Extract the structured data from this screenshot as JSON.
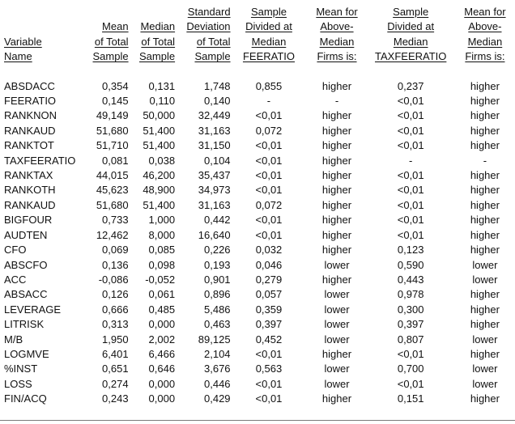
{
  "table": {
    "headers": [
      {
        "key": "variable",
        "lines": [
          "",
          "",
          "Variable",
          "Name"
        ]
      },
      {
        "key": "mean",
        "lines": [
          "",
          "Mean",
          "of Total",
          "Sample"
        ]
      },
      {
        "key": "median",
        "lines": [
          "",
          "Median",
          "of Total",
          "Sample"
        ]
      },
      {
        "key": "sd",
        "lines": [
          "Standard",
          "Deviation",
          "of Total",
          "Sample"
        ]
      },
      {
        "key": "fee_split",
        "lines": [
          "Sample",
          "Divided at",
          "Median",
          "FEERATIO"
        ]
      },
      {
        "key": "fee_direction",
        "lines": [
          "Mean for",
          "Above-",
          "Median",
          "Firms is:"
        ]
      },
      {
        "key": "tax_split",
        "lines": [
          "Sample",
          "Divided at",
          "Median",
          "TAXFEERATIO"
        ]
      },
      {
        "key": "tax_direction",
        "lines": [
          "Mean for",
          "Above-",
          "Median",
          "Firms is:"
        ]
      }
    ],
    "rows": [
      [
        "ABSDACC",
        "0,354",
        "0,131",
        "1,748",
        "0,855",
        "higher",
        "0,237",
        "higher"
      ],
      [
        "FEERATIO",
        "0,145",
        "0,110",
        "0,140",
        "-",
        "-",
        "<0,01",
        "higher"
      ],
      [
        "RANKNON",
        "49,149",
        "50,000",
        "32,449",
        "<0,01",
        "higher",
        "<0,01",
        "higher"
      ],
      [
        "RANKAUD",
        "51,680",
        "51,400",
        "31,163",
        "0,072",
        "higher",
        "<0,01",
        "higher"
      ],
      [
        "RANKTOT",
        "51,710",
        "51,400",
        "31,150",
        "<0,01",
        "higher",
        "<0,01",
        "higher"
      ],
      [
        "TAXFEERATIO",
        "0,081",
        "0,038",
        "0,104",
        "<0,01",
        "higher",
        "-",
        "-"
      ],
      [
        "RANKTAX",
        "44,015",
        "46,200",
        "35,437",
        "<0,01",
        "higher",
        "<0,01",
        "higher"
      ],
      [
        "RANKOTH",
        "45,623",
        "48,900",
        "34,973",
        "<0,01",
        "higher",
        "<0,01",
        "higher"
      ],
      [
        "RANKAUD",
        "51,680",
        "51,400",
        "31,163",
        "0,072",
        "higher",
        "<0,01",
        "higher"
      ],
      [
        "BIGFOUR",
        "0,733",
        "1,000",
        "0,442",
        "<0,01",
        "higher",
        "<0,01",
        "higher"
      ],
      [
        "AUDTEN",
        "12,462",
        "8,000",
        "16,640",
        "<0,01",
        "higher",
        "<0,01",
        "higher"
      ],
      [
        "CFO",
        "0,069",
        "0,085",
        "0,226",
        "0,032",
        "higher",
        "0,123",
        "higher"
      ],
      [
        "ABSCFO",
        "0,136",
        "0,098",
        "0,193",
        "0,046",
        "lower",
        "0,590",
        "lower"
      ],
      [
        "ACC",
        "-0,086",
        "-0,052",
        "0,901",
        "0,279",
        "higher",
        "0,443",
        "lower"
      ],
      [
        "ABSACC",
        "0,126",
        "0,061",
        "0,896",
        "0,057",
        "lower",
        "0,978",
        "higher"
      ],
      [
        "LEVERAGE",
        "0,666",
        "0,485",
        "5,486",
        "0,359",
        "lower",
        "0,300",
        "higher"
      ],
      [
        "LITRISK",
        "0,313",
        "0,000",
        "0,463",
        "0,397",
        "lower",
        "0,397",
        "higher"
      ],
      [
        "M/B",
        "1,950",
        "2,002",
        "89,125",
        "0,452",
        "lower",
        "0,807",
        "lower"
      ],
      [
        "LOGMVE",
        "6,401",
        "6,466",
        "2,104",
        "<0,01",
        "higher",
        "<0,01",
        "higher"
      ],
      [
        "%INST",
        "0,651",
        "0,646",
        "3,676",
        "0,563",
        "lower",
        "0,700",
        "lower"
      ],
      [
        "LOSS",
        "0,274",
        "0,000",
        "0,446",
        "<0,01",
        "lower",
        "<0,01",
        "lower"
      ],
      [
        "FIN/ACQ",
        "0,243",
        "0,000",
        "0,429",
        "<0,01",
        "higher",
        "0,151",
        "higher"
      ]
    ]
  }
}
